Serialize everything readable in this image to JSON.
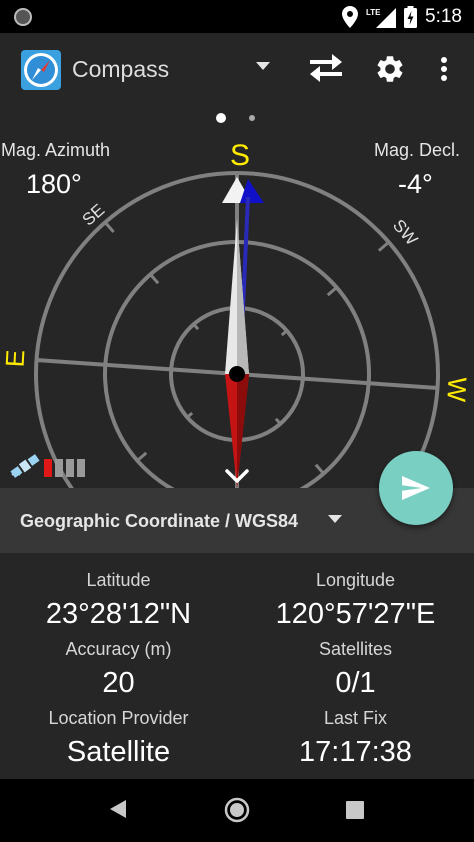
{
  "status_bar": {
    "time": "5:18",
    "network": "LTE",
    "icons": [
      "notification-dot-icon",
      "location-icon",
      "signal-icon",
      "battery-charging-icon"
    ]
  },
  "app_bar": {
    "title": "Compass",
    "icons": [
      "compass-logo-icon",
      "dropdown-arrow-icon",
      "swap-icon",
      "settings-icon",
      "more-vert-icon"
    ]
  },
  "compass": {
    "active_page": 1,
    "page_count": 2,
    "mag_azimuth_label": "Mag. Azimuth",
    "mag_azimuth_value": "180°",
    "mag_decl_label": "Mag. Decl.",
    "mag_decl_value": "-4°",
    "dial_labels": {
      "north_top": "S",
      "west_left": "E",
      "east_right": "W",
      "nw": "SE",
      "ne": "SW"
    },
    "accent_color": "#ffeb00",
    "satellite_signal_bars": 4,
    "satellite_signal_active": 1
  },
  "coordinate_system": {
    "label": "Geographic Coordinate / WGS84"
  },
  "info": {
    "latitude_label": "Latitude",
    "latitude_value": "23°28'12\"N",
    "longitude_label": "Longitude",
    "longitude_value": "120°57'27\"E",
    "accuracy_label": "Accuracy (m)",
    "accuracy_value": "20",
    "satellites_label": "Satellites",
    "satellites_value": "0/1",
    "provider_label": "Location Provider",
    "provider_value": "Satellite",
    "last_fix_label": "Last Fix",
    "last_fix_value": "17:17:38"
  },
  "colors": {
    "fab": "#79cfc2",
    "needle_red": "#c41414",
    "needle_blue": "#1414c8"
  }
}
